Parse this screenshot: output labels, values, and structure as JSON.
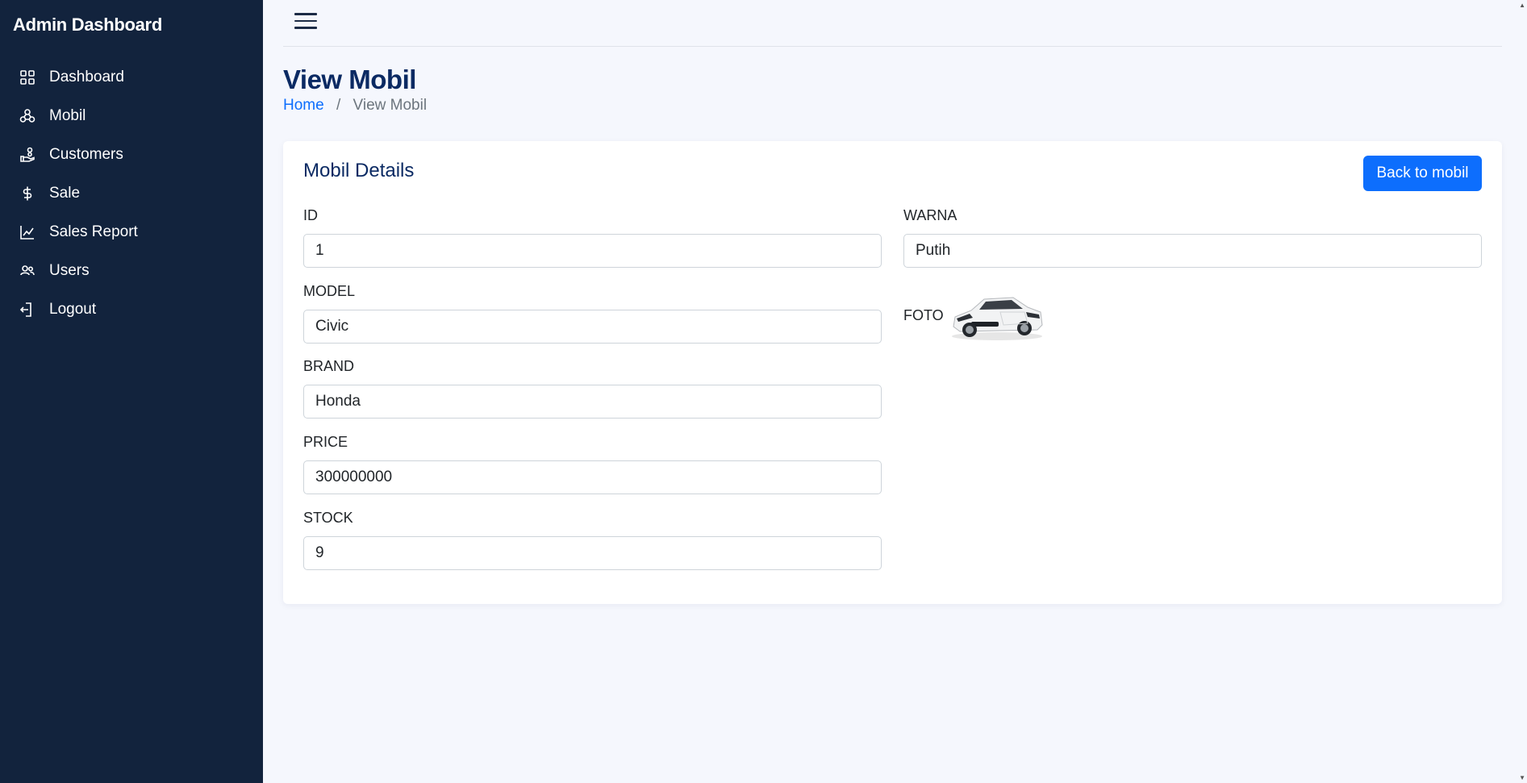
{
  "sidebar": {
    "brand": "Admin Dashboard",
    "items": [
      {
        "label": "Dashboard",
        "icon": "grid-icon"
      },
      {
        "label": "Mobil",
        "icon": "webhook-icon"
      },
      {
        "label": "Customers",
        "icon": "hand-coins-icon"
      },
      {
        "label": "Sale",
        "icon": "dollar-icon"
      },
      {
        "label": "Sales Report",
        "icon": "line-chart-icon"
      },
      {
        "label": "Users",
        "icon": "users-icon"
      },
      {
        "label": "Logout",
        "icon": "logout-icon"
      }
    ]
  },
  "header": {
    "menu_icon": "hamburger-icon",
    "title": "View Mobil",
    "breadcrumb": {
      "home": "Home",
      "separator": "/",
      "current": "View Mobil"
    }
  },
  "card": {
    "title": "Mobil Details",
    "back_button": "Back to mobil",
    "fields": {
      "id": {
        "label": "ID",
        "value": "1"
      },
      "model": {
        "label": "MODEL",
        "value": "Civic"
      },
      "brand": {
        "label": "BRAND",
        "value": "Honda"
      },
      "price": {
        "label": "PRICE",
        "value": "300000000"
      },
      "stock": {
        "label": "STOCK",
        "value": "9"
      },
      "warna": {
        "label": "WARNA",
        "value": "Putih"
      },
      "foto": {
        "label": "FOTO"
      }
    }
  },
  "colors": {
    "sidebar_bg": "#12233d",
    "accent": "#0d6efd",
    "title": "#0b2a63",
    "page_bg": "#f5f7fd"
  }
}
